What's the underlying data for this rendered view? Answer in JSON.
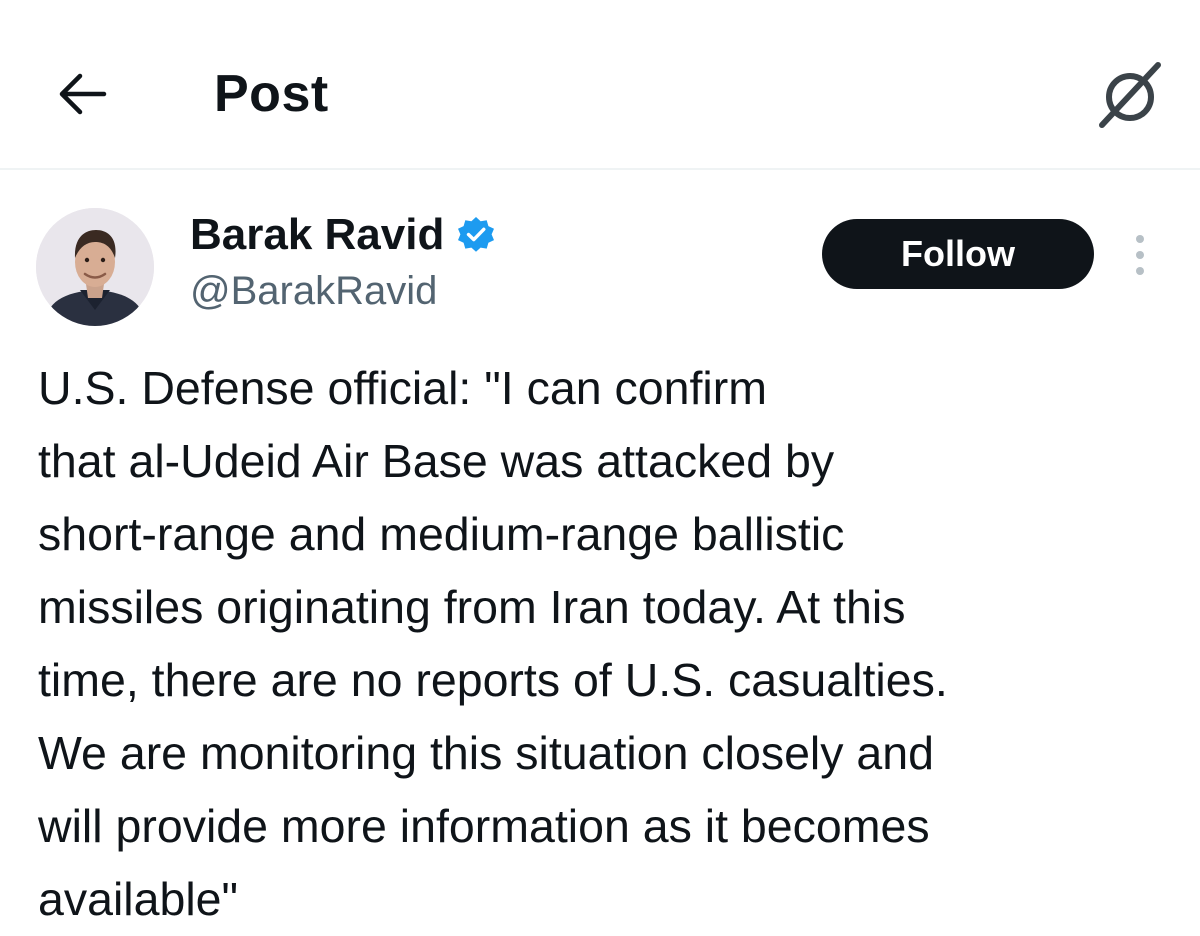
{
  "header": {
    "back_icon": "arrow-left-icon",
    "title": "Post",
    "grok_icon": "grok-icon"
  },
  "post": {
    "author": {
      "name": "Barak Ravid",
      "handle": "@BarakRavid",
      "verified": true,
      "verified_color": "#1d9bf0"
    },
    "follow_label": "Follow",
    "more_icon": "more-vertical-icon",
    "text_lines": [
      "U.S. Defense official: \"I can confirm",
      "that al-Udeid Air Base was attacked by",
      "short-range and medium-range ballistic",
      "missiles originating from Iran today. At this",
      "time, there are no reports of U.S. casualties.",
      "We are monitoring this situation closely and",
      "will provide more information as it becomes",
      "available\""
    ]
  },
  "colors": {
    "text": "#0f1419",
    "secondary": "#536471",
    "button": "#0f1419",
    "divider": "#eff3f4"
  }
}
